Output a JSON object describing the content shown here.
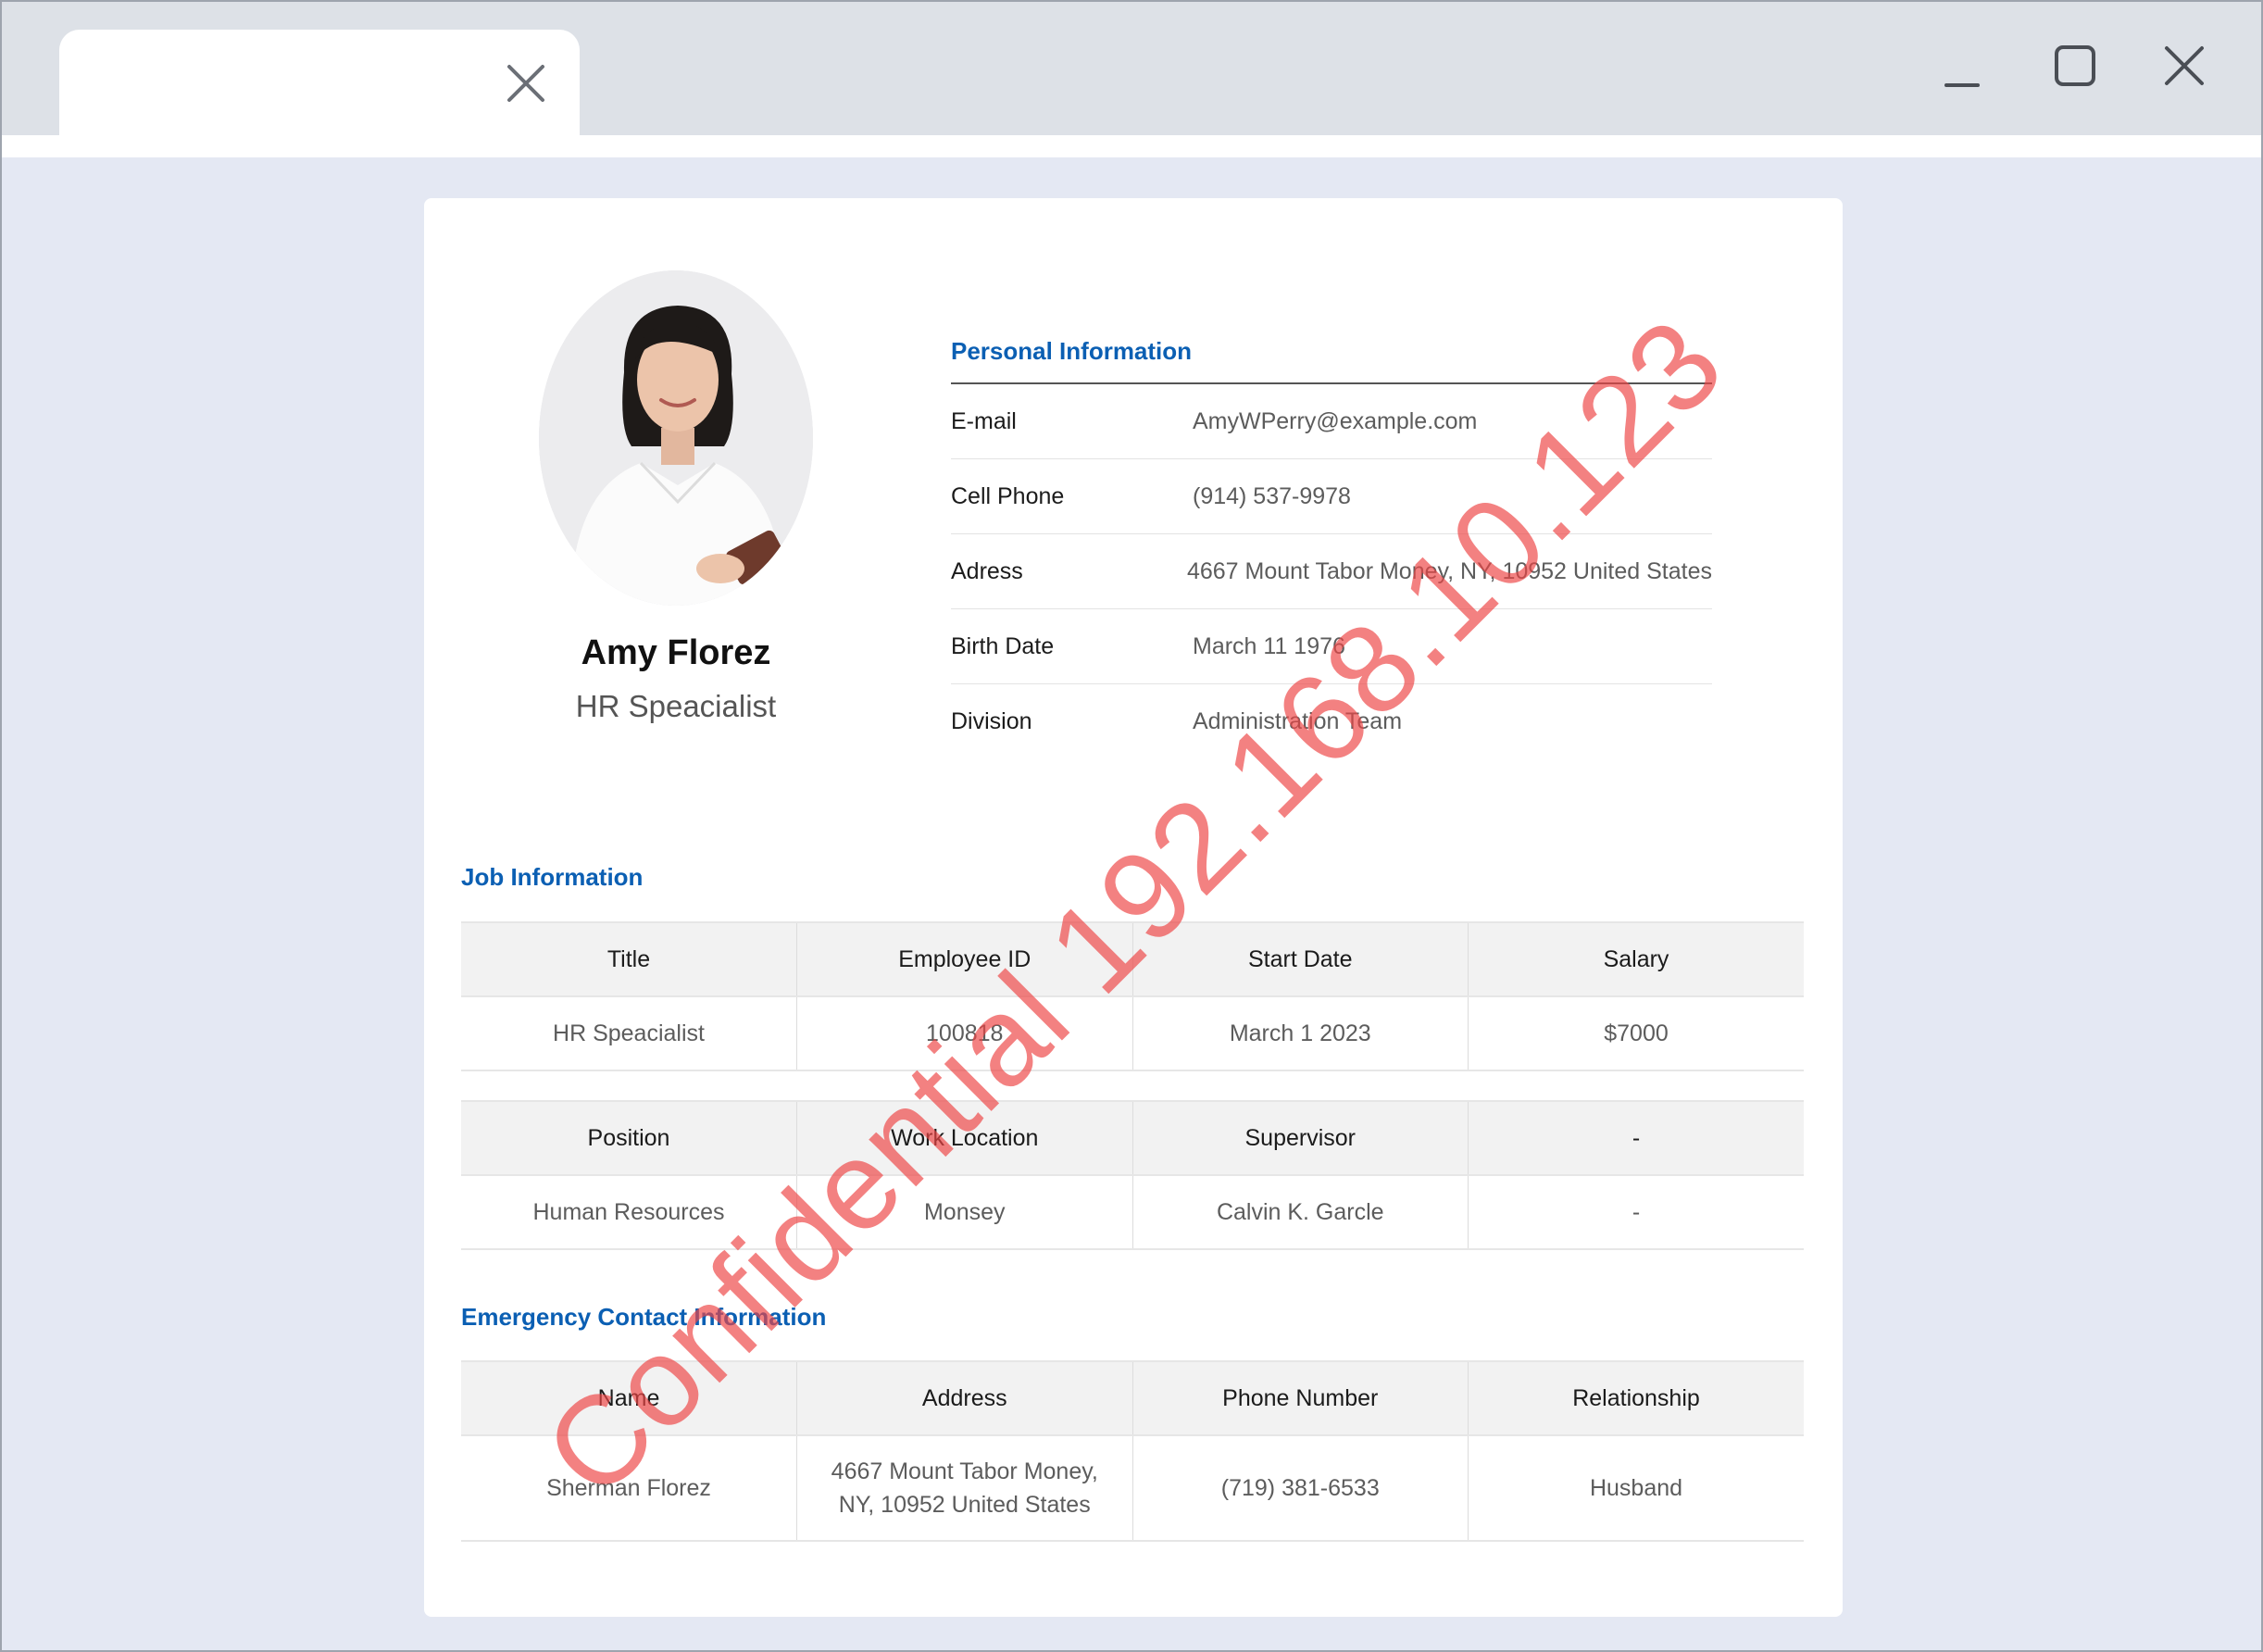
{
  "profile": {
    "name": "Amy Florez",
    "role": "HR Speacialist"
  },
  "personal": {
    "title": "Personal Information",
    "rows": [
      {
        "label": "E-mail",
        "value": "AmyWPerry@example.com"
      },
      {
        "label": "Cell Phone",
        "value": "(914) 537-9978"
      },
      {
        "label": "Adress",
        "value": "4667 Mount Tabor Money, NY, 10952 United States"
      },
      {
        "label": "Birth Date",
        "value": "March 11 1976"
      },
      {
        "label": "Division",
        "value": "Administration Team"
      }
    ]
  },
  "job": {
    "title": "Job Information",
    "table1": {
      "headers": [
        "Title",
        "Employee ID",
        "Start Date",
        "Salary"
      ],
      "values": [
        "HR Speacialist",
        "100818",
        "March 1 2023",
        "$7000"
      ]
    },
    "table2": {
      "headers": [
        "Position",
        "Work Location",
        "Supervisor",
        "-"
      ],
      "values": [
        "Human Resources",
        "Monsey",
        "Calvin K. Garcle",
        "-"
      ]
    }
  },
  "emergency": {
    "title": "Emergency Contact Information",
    "headers": [
      "Name",
      "Address",
      "Phone Number",
      "Relationship"
    ],
    "values": [
      "Sherman Florez",
      "4667 Mount Tabor Money, NY, 10952 United States",
      "(719) 381-6533",
      "Husband"
    ]
  },
  "watermark": "Confidential 192.168.10.123",
  "colors": {
    "accent": "#0b5fb3",
    "watermark": "#ee4646",
    "background": "#e4e8f3"
  }
}
